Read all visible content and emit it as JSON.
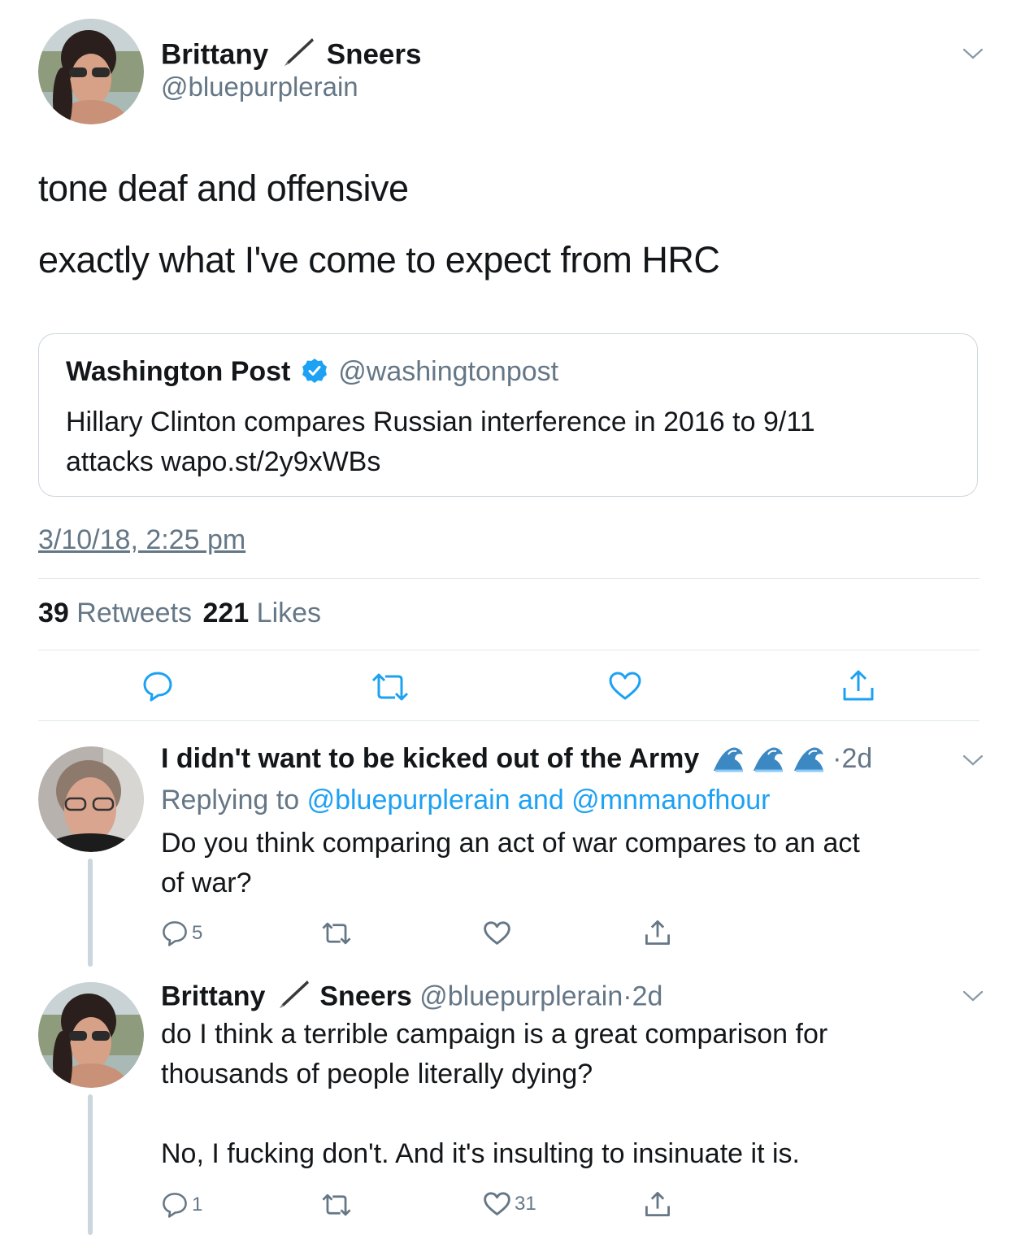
{
  "main_tweet": {
    "name_first": "Brittany",
    "name_icon": "pen-emoji",
    "name_last": "Sneers",
    "handle": "@bluepurplerain",
    "text_line1": "tone deaf and offensive",
    "text_line2": "exactly what I've come to expect from HRC",
    "timestamp": "3/10/18, 2:25 pm",
    "retweet_count": "39",
    "retweets_label": "Retweets",
    "like_count": "221",
    "likes_label": "Likes"
  },
  "quoted_tweet": {
    "name": "Washington Post",
    "verified_icon": "verified-badge",
    "handle": "@washingtonpost",
    "text_line1": "Hillary Clinton compares Russian interference in 2016 to 9/11",
    "text_line2": "attacks wapo.st/2y9xWBs"
  },
  "reply1": {
    "name": "I didn't want to be kicked out of the Army",
    "name_icons": [
      "wave-emoji",
      "wave-emoji",
      "wave-emoji"
    ],
    "separator": "·",
    "time": "2d",
    "replying_prefix": "Replying to",
    "replying_to": "@bluepurplerain and @mnmanofhour",
    "text_line1": "Do you think comparing an act of war compares to an act",
    "text_line2": "of war?",
    "reply_count": "5"
  },
  "reply2": {
    "name_first": "Brittany",
    "name_last": "Sneers",
    "handle": "@bluepurplerain",
    "separator": "·",
    "time": "2d",
    "text_line1": "do I think a terrible campaign is a great comparison for",
    "text_line2": "thousands of people literally dying?",
    "text_line3": "No, I fucking don't. And it's insulting to insinuate it is.",
    "reply_count": "1",
    "like_count": "31"
  },
  "colors": {
    "text": "#14171a",
    "secondary": "#657786",
    "link": "#1da1f2",
    "border": "#e1e8ed"
  }
}
